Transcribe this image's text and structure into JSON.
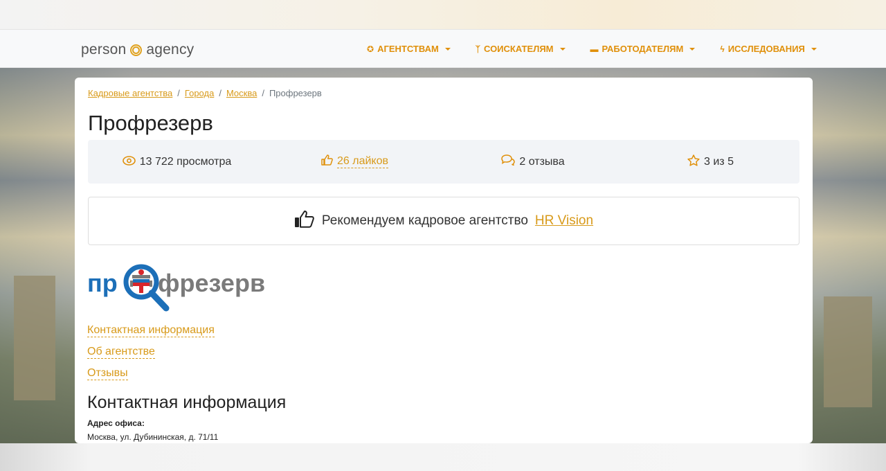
{
  "brand": {
    "text_left": "person",
    "text_right": "agency",
    "logo_icon": "target-circle-icon"
  },
  "nav": {
    "items": [
      {
        "label": "АГЕНТСТВАМ",
        "icon": "lifebuoy-icon"
      },
      {
        "label": "СОИСКАТЕЛЯМ",
        "icon": "person-icon"
      },
      {
        "label": "РАБОТОДАТЕЛЯМ",
        "icon": "briefcase-icon"
      },
      {
        "label": "ИССЛЕДОВАНИЯ",
        "icon": "lightning-icon"
      }
    ]
  },
  "breadcrumb": {
    "items": [
      "Кадровые агентства",
      "Города",
      "Москва"
    ],
    "current": "Профрезерв",
    "separator": "/"
  },
  "page": {
    "title": "Профрезерв"
  },
  "stats": {
    "views": "13 722 просмотра",
    "likes": "26 лайков",
    "reviews": "2 отзыва",
    "rating": "3 из 5"
  },
  "recommend": {
    "text": "Рекомендуем кадровое агентство",
    "link": "HR Vision"
  },
  "logo": {
    "text_left": "пр",
    "text_right": "фрезерв"
  },
  "anchors": {
    "contacts": "Контактная информация",
    "about": "Об агентстве",
    "reviews": "Отзывы"
  },
  "contacts": {
    "title": "Контактная информация",
    "address_label": "Адрес офиса:",
    "address_value": "Москва, ул. Дубининская, д. 71/11"
  },
  "colors": {
    "accent": "#e0900a",
    "link": "#d89a1a",
    "logo_blue": "#1c6fb8",
    "logo_red": "#d8262b",
    "logo_grey": "#7a7a7a"
  }
}
